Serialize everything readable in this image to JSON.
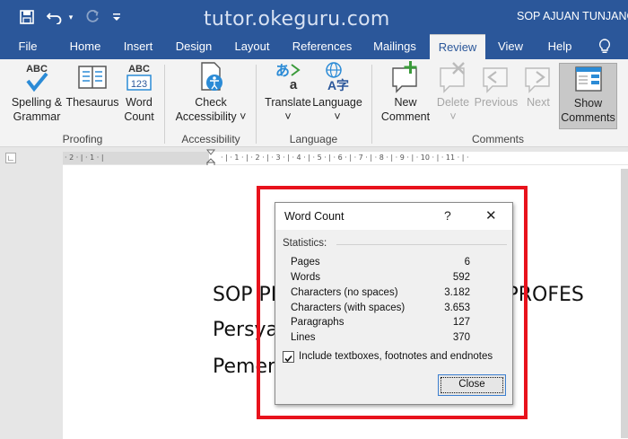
{
  "window": {
    "watermark": "tutor.okeguru.com",
    "doc_title": "SOP AJUAN TUNJANG"
  },
  "qat": {
    "save_icon": "save-icon",
    "undo_icon": "undo-icon",
    "redo_icon": "redo-icon",
    "customize_icon": "customize-icon"
  },
  "tabs": [
    "File",
    "Home",
    "Insert",
    "Design",
    "Layout",
    "References",
    "Mailings",
    "Review",
    "View",
    "Help"
  ],
  "active_tab": "Review",
  "ribbon": {
    "spelling": {
      "line1": "Spelling &",
      "line2": "Grammar",
      "icon_text": "ABC"
    },
    "thesaurus": {
      "label": "Thesaurus"
    },
    "wordcount": {
      "line1": "Word",
      "line2": "Count",
      "icon_text1": "ABC",
      "icon_text2": "123"
    },
    "check": {
      "line1": "Check",
      "line2": "Accessibility ˅"
    },
    "translate": {
      "label": "Translate",
      "line2": "˅"
    },
    "language": {
      "label": "Language",
      "line2": "˅",
      "icon_text": "A字"
    },
    "newcomment": {
      "line1": "New",
      "line2": "Comment"
    },
    "delete": {
      "label": "Delete",
      "line2": "˅"
    },
    "previous": {
      "label": "Previous"
    },
    "next": {
      "label": "Next"
    },
    "showcomments": {
      "line1": "Show",
      "line2": "Comments"
    },
    "groups": {
      "proofing": "Proofing",
      "accessibility": "Accessibility",
      "language": "Language",
      "comments": "Comments"
    }
  },
  "ruler": {
    "left_marks": "· 2 · | · 1 · |",
    "right_marks": "· | · 1 · | · 2 · | · 3 · | · 4 · | · 5 · | · 6 · | · 7 · | · 8 · | · 9 · | · 10 · | · 11 · | ·"
  },
  "document": {
    "lines": [
      "SOP PENGAJUAN TUNJANGAN PROFES",
      "Persyaratan Tunjangan Pro",
      "Pemerintah Tahun 2019"
    ]
  },
  "dialog": {
    "title": "Word Count",
    "help": "?",
    "close_glyph": "✕",
    "section": "Statistics:",
    "rows": [
      {
        "label": "Pages",
        "value": "6"
      },
      {
        "label": "Words",
        "value": "592"
      },
      {
        "label": "Characters (no spaces)",
        "value": "3.182"
      },
      {
        "label": "Characters (with spaces)",
        "value": "3.653"
      },
      {
        "label": "Paragraphs",
        "value": "127"
      },
      {
        "label": "Lines",
        "value": "370"
      }
    ],
    "checkbox_label": "Include textboxes, footnotes and endnotes",
    "checkbox_checked": true,
    "close_button": "Close"
  },
  "colors": {
    "title_bar": "#2b579a",
    "ribbon_bg": "#f3f3f3",
    "highlight_box": "#e8121c",
    "check_icon_blue": "#2b8bd6",
    "comment_green": "#3a9a3a"
  }
}
